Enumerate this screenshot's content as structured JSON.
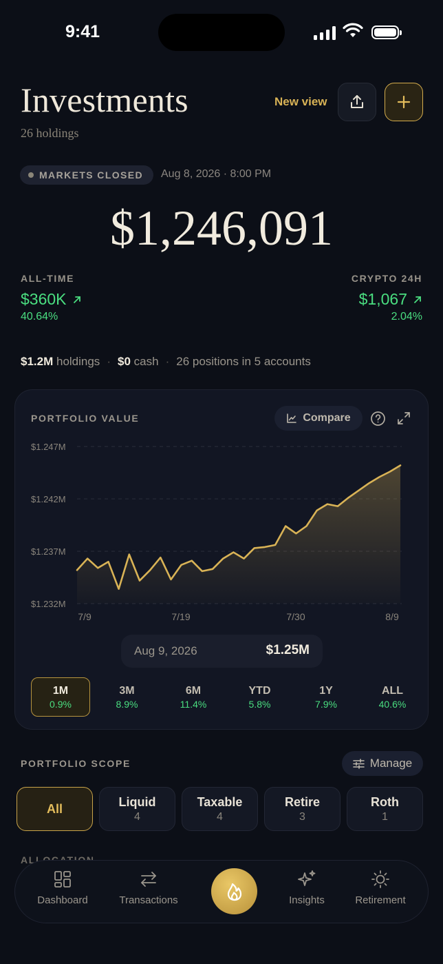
{
  "status": {
    "time": "9:41"
  },
  "header": {
    "title": "Investments",
    "subtitle": "26 holdings",
    "new_view": "New view",
    "share_icon": "share-icon",
    "add_icon": "plus-icon"
  },
  "market": {
    "status": "MARKETS CLOSED",
    "datetime": "Aug 8, 2026 · 8:00 PM"
  },
  "total_value": "$1,246,091",
  "stats": {
    "all_time": {
      "label": "ALL-TIME",
      "value": "$360K",
      "pct": "40.64%"
    },
    "crypto": {
      "label": "CRYPTO 24H",
      "value": "$1,067",
      "pct": "2.04%"
    }
  },
  "summary": {
    "holdings_value": "$1.2M",
    "holdings_label": "holdings",
    "cash_value": "$0",
    "cash_label": "cash",
    "positions": "26 positions in 5 accounts"
  },
  "portfolio_card": {
    "title": "PORTFOLIO VALUE",
    "compare_label": "Compare",
    "selected_date": "Aug 9, 2026",
    "selected_value": "$1.25M",
    "ranges": [
      {
        "label": "1M",
        "pct": "0.9%",
        "active": true
      },
      {
        "label": "3M",
        "pct": "8.9%",
        "active": false
      },
      {
        "label": "6M",
        "pct": "11.4%",
        "active": false
      },
      {
        "label": "YTD",
        "pct": "5.8%",
        "active": false
      },
      {
        "label": "1Y",
        "pct": "7.9%",
        "active": false
      },
      {
        "label": "ALL",
        "pct": "40.6%",
        "active": false
      }
    ]
  },
  "chart_data": {
    "type": "area",
    "title": "PORTFOLIO VALUE",
    "xlabel": "",
    "ylabel": "",
    "y_tick_labels": [
      "$1.247M",
      "$1.242M",
      "$1.237M",
      "$1.232M"
    ],
    "y_ticks": [
      1.247,
      1.242,
      1.237,
      1.232
    ],
    "ylim": [
      1.232,
      1.247
    ],
    "y_unit": "$M",
    "x_tick_labels": [
      "7/9",
      "7/19",
      "7/30",
      "8/9"
    ],
    "grid": true,
    "color": "#d9b356",
    "series": [
      {
        "values": [
          1.2352,
          1.2363,
          1.2354,
          1.236,
          1.2334,
          1.2367,
          1.2342,
          1.2352,
          1.2364,
          1.2343,
          1.2357,
          1.2361,
          1.2351,
          1.2353,
          1.2363,
          1.2369,
          1.2363,
          1.2373,
          1.2374,
          1.2376,
          1.2394,
          1.2387,
          1.2394,
          1.2409,
          1.2415,
          1.2413,
          1.2421,
          1.2428,
          1.2435,
          1.2441,
          1.2446,
          1.2452
        ]
      }
    ]
  },
  "scope": {
    "title": "PORTFOLIO SCOPE",
    "manage_label": "Manage",
    "items": [
      {
        "label": "All",
        "count": "",
        "active": true
      },
      {
        "label": "Liquid",
        "count": "4",
        "active": false
      },
      {
        "label": "Taxable",
        "count": "4",
        "active": false
      },
      {
        "label": "Retire",
        "count": "3",
        "active": false
      },
      {
        "label": "Roth",
        "count": "1",
        "active": false
      }
    ]
  },
  "allocation_title": "ALLOCATION",
  "nav": {
    "items": [
      {
        "label": "Dashboard",
        "icon": "dashboard-icon"
      },
      {
        "label": "Transactions",
        "icon": "transactions-icon"
      },
      {
        "label": "",
        "icon": "flame-icon"
      },
      {
        "label": "Insights",
        "icon": "sparkle-icon"
      },
      {
        "label": "Retirement",
        "icon": "sun-icon"
      }
    ]
  }
}
